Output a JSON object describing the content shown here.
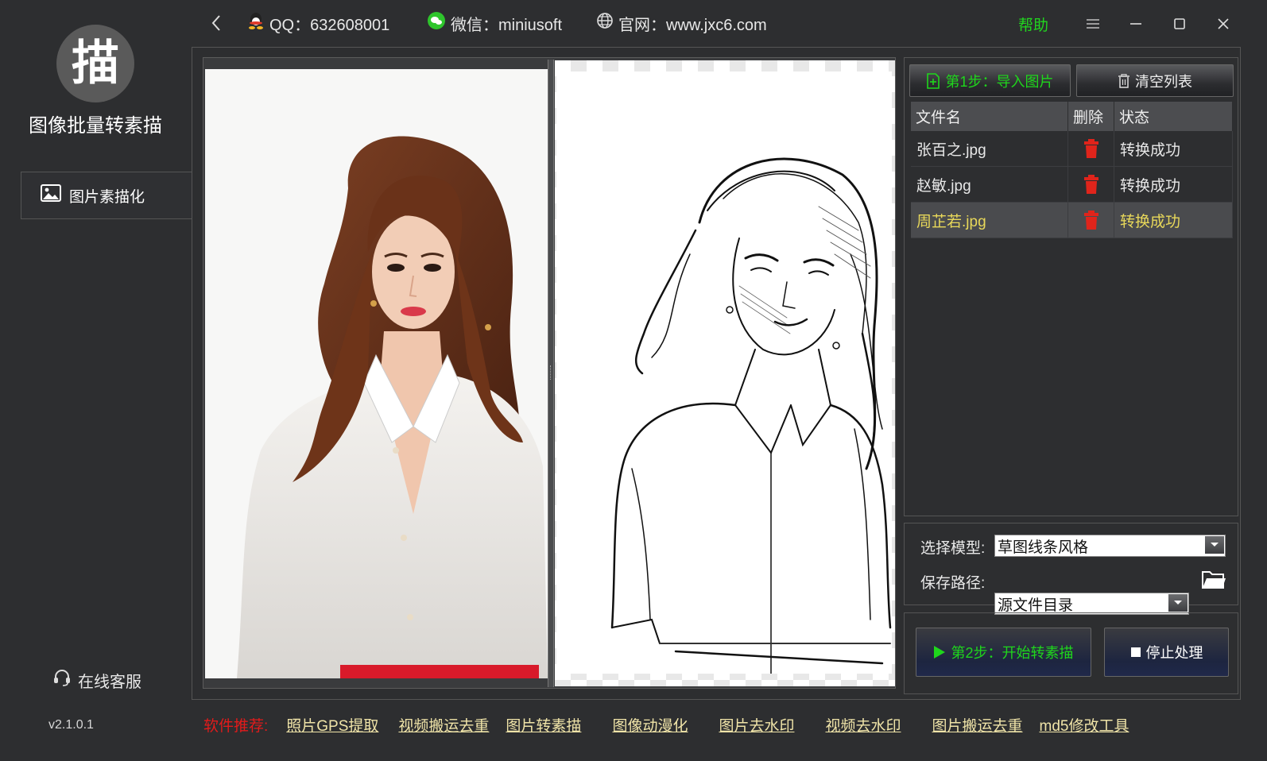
{
  "app": {
    "logo_char": "描",
    "title": "图像批量转素描",
    "version": "v2.1.0.1"
  },
  "sidebar": {
    "items": [
      {
        "label": "图片素描化"
      }
    ],
    "support_label": "在线客服"
  },
  "topbar": {
    "qq": "QQ：632608001",
    "wechat": "微信：miniusoft",
    "website": "官网：www.jxc6.com",
    "help": "帮助"
  },
  "toolbar": {
    "import_label": "第1步：导入图片",
    "clear_label": "清空列表"
  },
  "table": {
    "headers": [
      "文件名",
      "删除",
      "状态"
    ],
    "rows": [
      {
        "name": "张百之.jpg",
        "status": "转换成功"
      },
      {
        "name": "赵敏.jpg",
        "status": "转换成功"
      },
      {
        "name": "周芷若.jpg",
        "status": "转换成功",
        "selected": true
      }
    ]
  },
  "settings": {
    "model_label": "选择模型:",
    "model_value": "草图线条风格",
    "path_label": "保存路径:",
    "path_value": "源文件目录"
  },
  "actions": {
    "start_label": "第2步：开始转素描",
    "stop_label": "停止处理"
  },
  "footer": {
    "recommend_label": "软件推荐:",
    "links": [
      "照片GPS提取",
      "视频搬运去重",
      "图片转素描",
      "图像动漫化",
      "图片去水印",
      "视频去水印",
      "图片搬运去重",
      "md5修改工具"
    ]
  },
  "colors": {
    "background": "#2d2e30",
    "accent_green": "#1fd61c",
    "selected_text": "#e8d85a",
    "delete_red": "#e0241b",
    "footer_red": "#e21b1b",
    "link_color": "#f0e4a8"
  }
}
